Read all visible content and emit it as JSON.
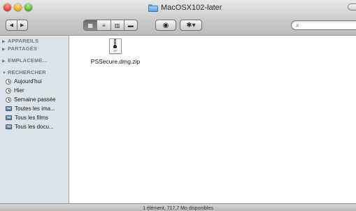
{
  "window": {
    "title": "MacOSX102-later"
  },
  "toolbar": {
    "back_icon": "back-arrow-icon",
    "forward_icon": "forward-arrow-icon",
    "back_glyph": "◀",
    "forward_glyph": "▶",
    "views": [
      {
        "name": "icon-view",
        "glyph": "▦",
        "active": true
      },
      {
        "name": "list-view",
        "glyph": "≡",
        "active": false
      },
      {
        "name": "column-view",
        "glyph": "▥",
        "active": false
      },
      {
        "name": "coverflow-view",
        "glyph": "▬",
        "active": false
      }
    ],
    "quicklook_glyph": "◉",
    "action_glyph": "✱▾",
    "search_placeholder": ""
  },
  "sidebar": {
    "sections": [
      {
        "label": "APPAREILS",
        "expanded": false
      },
      {
        "label": "PARTAGÉS",
        "expanded": false
      },
      {
        "label": "EMPLACEME...",
        "expanded": false
      },
      {
        "label": "RECHERCHER",
        "expanded": true
      }
    ],
    "search_items": [
      {
        "label": "Aujourd'hui",
        "icon": "clock-icon"
      },
      {
        "label": "Hier",
        "icon": "clock-icon"
      },
      {
        "label": "Semaine passée",
        "icon": "clock-icon"
      },
      {
        "label": "Toutes les ima...",
        "icon": "smart-folder-icon"
      },
      {
        "label": "Tous les films",
        "icon": "smart-folder-icon"
      },
      {
        "label": "Tous les docu...",
        "icon": "smart-folder-icon"
      }
    ]
  },
  "content": {
    "files": [
      {
        "name": "PSSecure.dmg.zip",
        "icon": "zip-file-icon",
        "icon_label": "ZIP"
      }
    ]
  },
  "status": {
    "text": "1 élément, 717,7 Mo disponibles"
  }
}
